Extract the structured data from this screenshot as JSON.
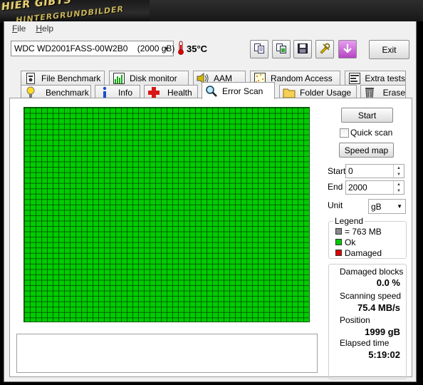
{
  "menu": {
    "file": "File",
    "help": "Help"
  },
  "toolbar": {
    "drive": "WDC WD2001FASS-00W2B0    (2000 gB)",
    "temperature": "35°C",
    "exit_label": "Exit"
  },
  "tabs_top": [
    {
      "label": "File Benchmark",
      "icon": "file-benchmark-icon"
    },
    {
      "label": "Disk monitor",
      "icon": "disk-monitor-icon"
    },
    {
      "label": "AAM",
      "icon": "speaker-icon"
    },
    {
      "label": "Random Access",
      "icon": "random-access-icon"
    },
    {
      "label": "Extra tests",
      "icon": "extra-tests-icon"
    }
  ],
  "tabs_bottom": [
    {
      "label": "Benchmark",
      "icon": "benchmark-icon"
    },
    {
      "label": "Info",
      "icon": "info-icon"
    },
    {
      "label": "Health",
      "icon": "health-cross-icon"
    },
    {
      "label": "Error Scan",
      "icon": "magnifier-icon",
      "active": true
    },
    {
      "label": "Folder Usage",
      "icon": "folder-icon"
    },
    {
      "label": "Erase",
      "icon": "trash-icon"
    }
  ],
  "controls": {
    "start_button": "Start",
    "quick_scan": "Quick scan",
    "quick_scan_checked": false,
    "speed_map_button": "Speed map",
    "start_label": "Start",
    "start_value": "0",
    "end_label": "End",
    "end_value": "2000",
    "unit_label": "Unit",
    "unit_value": "gB"
  },
  "legend": {
    "title": "Legend",
    "items": [
      {
        "label": "= 763 MB",
        "color": "#8a8a8a"
      },
      {
        "label": "Ok",
        "color": "#00cc00"
      },
      {
        "label": "Damaged",
        "color": "#dd0000"
      }
    ]
  },
  "stats": {
    "damaged_blocks_label": "Damaged blocks",
    "damaged_blocks_value": "0.0 %",
    "scanning_speed_label": "Scanning speed",
    "scanning_speed_value": "75.4 MB/s",
    "position_label": "Position",
    "position_value": "1999 gB",
    "elapsed_label": "Elapsed time",
    "elapsed_value": "5:19:02"
  },
  "scan_grid": {
    "block_color": "#00cc00",
    "damaged_percent": 0.0
  }
}
